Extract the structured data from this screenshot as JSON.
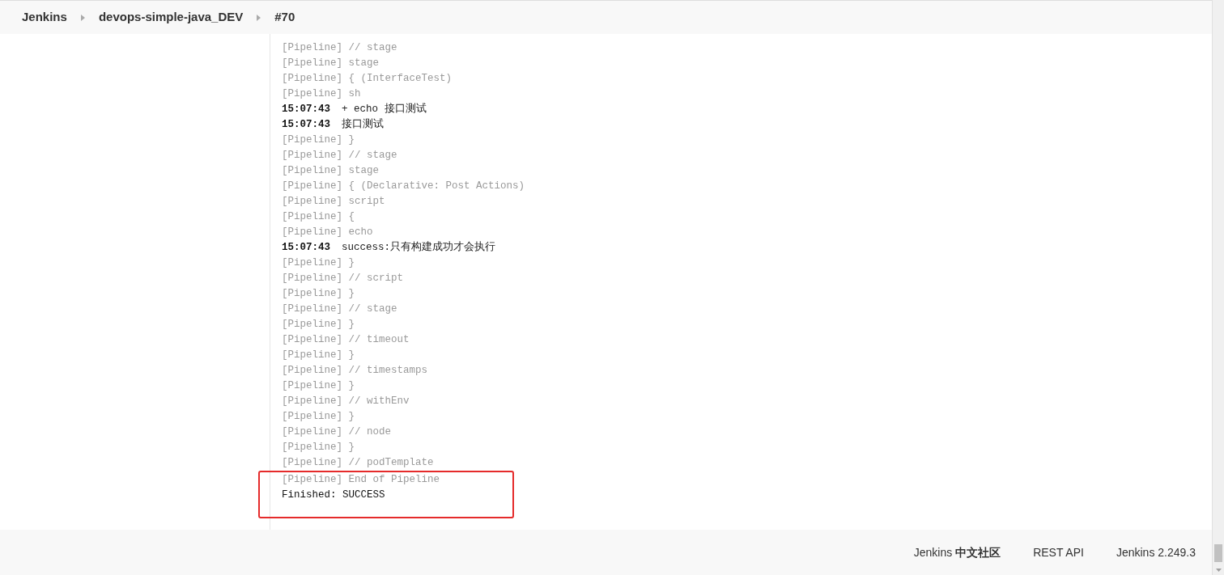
{
  "breadcrumbs": [
    {
      "label": "Jenkins"
    },
    {
      "label": "devops-simple-java_DEV"
    },
    {
      "label": "#70"
    }
  ],
  "log": {
    "lines": [
      {
        "kind": "pipeline",
        "text": "[Pipeline] // stage"
      },
      {
        "kind": "pipeline",
        "text": "[Pipeline] stage"
      },
      {
        "kind": "pipeline",
        "text": "[Pipeline] { (InterfaceTest)"
      },
      {
        "kind": "pipeline",
        "text": "[Pipeline] sh"
      },
      {
        "kind": "timestamped",
        "time": "15:07:43",
        "text": "+ echo 接口测试"
      },
      {
        "kind": "timestamped",
        "time": "15:07:43",
        "text": "接口测试"
      },
      {
        "kind": "pipeline",
        "text": "[Pipeline] }"
      },
      {
        "kind": "pipeline",
        "text": "[Pipeline] // stage"
      },
      {
        "kind": "pipeline",
        "text": "[Pipeline] stage"
      },
      {
        "kind": "pipeline",
        "text": "[Pipeline] { (Declarative: Post Actions)"
      },
      {
        "kind": "pipeline",
        "text": "[Pipeline] script"
      },
      {
        "kind": "pipeline",
        "text": "[Pipeline] {"
      },
      {
        "kind": "pipeline",
        "text": "[Pipeline] echo"
      },
      {
        "kind": "timestamped",
        "time": "15:07:43",
        "text": "success:只有构建成功才会执行"
      },
      {
        "kind": "pipeline",
        "text": "[Pipeline] }"
      },
      {
        "kind": "pipeline",
        "text": "[Pipeline] // script"
      },
      {
        "kind": "pipeline",
        "text": "[Pipeline] }"
      },
      {
        "kind": "pipeline",
        "text": "[Pipeline] // stage"
      },
      {
        "kind": "pipeline",
        "text": "[Pipeline] }"
      },
      {
        "kind": "pipeline",
        "text": "[Pipeline] // timeout"
      },
      {
        "kind": "pipeline",
        "text": "[Pipeline] }"
      },
      {
        "kind": "pipeline",
        "text": "[Pipeline] // timestamps"
      },
      {
        "kind": "pipeline",
        "text": "[Pipeline] }"
      },
      {
        "kind": "pipeline",
        "text": "[Pipeline] // withEnv"
      },
      {
        "kind": "pipeline",
        "text": "[Pipeline] }"
      },
      {
        "kind": "pipeline",
        "text": "[Pipeline] // node"
      },
      {
        "kind": "pipeline",
        "text": "[Pipeline] }"
      },
      {
        "kind": "pipeline",
        "text": "[Pipeline] // podTemplate"
      }
    ],
    "highlighted": [
      {
        "kind": "pipeline",
        "text": "[Pipeline] End of Pipeline"
      },
      {
        "kind": "plain",
        "text": "Finished: SUCCESS"
      }
    ]
  },
  "footer": {
    "links": [
      {
        "label": "Jenkins **中文社区**"
      },
      {
        "label": "REST API"
      },
      {
        "label": "Jenkins 2.249.3"
      }
    ]
  }
}
